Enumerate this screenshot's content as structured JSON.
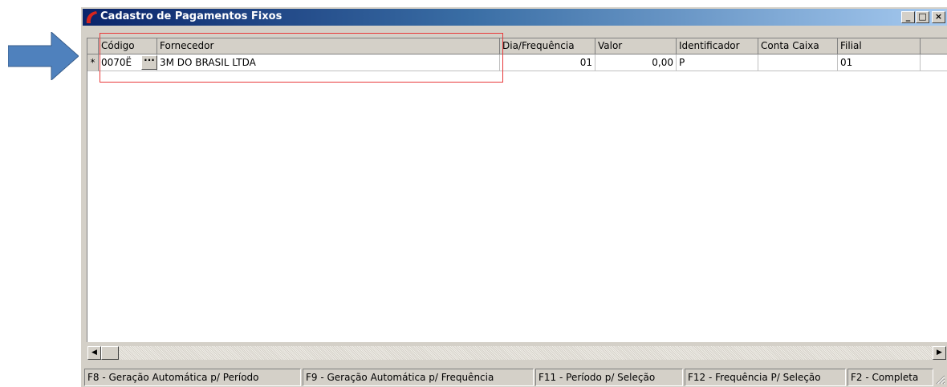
{
  "window": {
    "title": "Cadastro de Pagamentos Fixos",
    "controls": {
      "minimize": "_",
      "maximize": "□",
      "close": "×"
    }
  },
  "grid": {
    "columns": [
      "Código",
      "Fornecedor",
      "Dia/Frequência",
      "Valor",
      "Identificador",
      "Conta Caixa",
      "Filial"
    ],
    "rows": [
      {
        "indicator": "*",
        "codigo": "0070Ë",
        "fornecedor": "3M DO BRASIL LTDA",
        "dia_frequencia": "01",
        "valor": "0,00",
        "identificador": "P",
        "conta_caixa": "",
        "filial": "01"
      }
    ],
    "ellipsis_label": "···"
  },
  "statusbar": {
    "panels": [
      "F8 - Geração Automática p/ Período",
      "F9 - Geração Automática p/ Frequência",
      "F11 - Período p/ Seleção",
      "F12 - Frequência P/ Seleção",
      "F2 - Completa"
    ]
  },
  "colors": {
    "arrow": "#4f81bd",
    "highlight": "#e8393a",
    "titlebar": "#0a246a"
  },
  "icons": {
    "arrow": "right-arrow-icon",
    "app": "app-logo-icon",
    "resize": "size-grip-icon"
  }
}
